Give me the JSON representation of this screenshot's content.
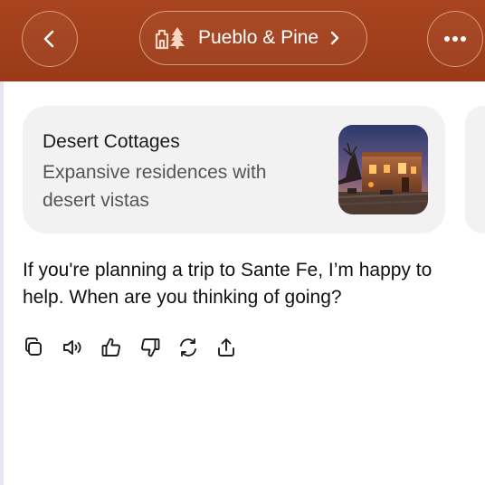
{
  "header": {
    "title": "Pueblo & Pine",
    "icons": [
      "back-chevron-icon",
      "pueblo-pine-logo-icon",
      "chevron-right-icon",
      "more-icon"
    ]
  },
  "card": {
    "title": "Desert Cottages",
    "description": "Expansive residences with desert vistas",
    "image": "adobe-house-at-dusk"
  },
  "message": {
    "text": "If you're planning a trip to Sante Fe, I’m happy to help. When are you thinking of going?"
  },
  "actions": [
    "copy-icon",
    "speaker-icon",
    "thumbs-up-icon",
    "thumbs-down-icon",
    "regenerate-icon",
    "share-icon"
  ],
  "colors": {
    "header": "#a8441f",
    "card_bg": "#f2f2f3",
    "text": "#111111",
    "muted": "#555555"
  }
}
